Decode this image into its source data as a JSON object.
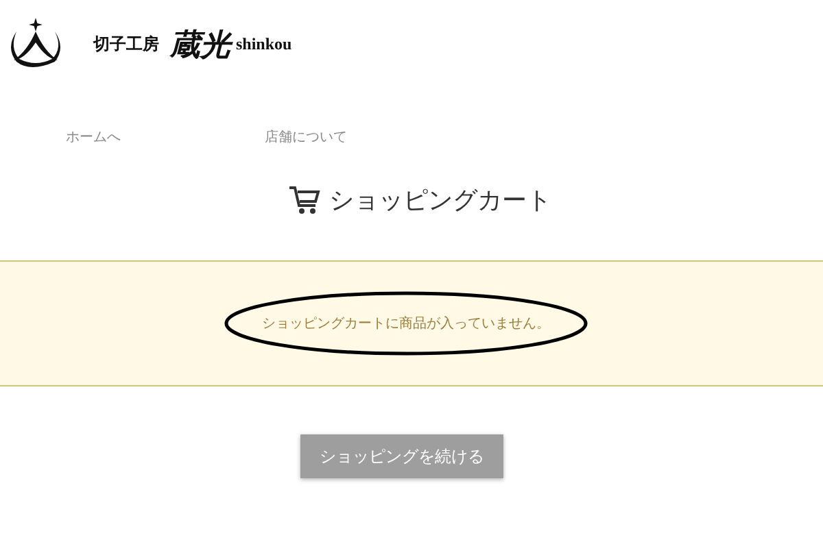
{
  "header": {
    "logo_prefix": "切子工房",
    "logo_name": "蔵光",
    "logo_suffix": "shinkou"
  },
  "nav": [
    {
      "label": "ホームへ"
    },
    {
      "label": "店舗について"
    }
  ],
  "title": "ショッピングカート",
  "notice": {
    "message": "ショッピングカートに商品が入っていません。"
  },
  "button": "ショッピングを続ける"
}
